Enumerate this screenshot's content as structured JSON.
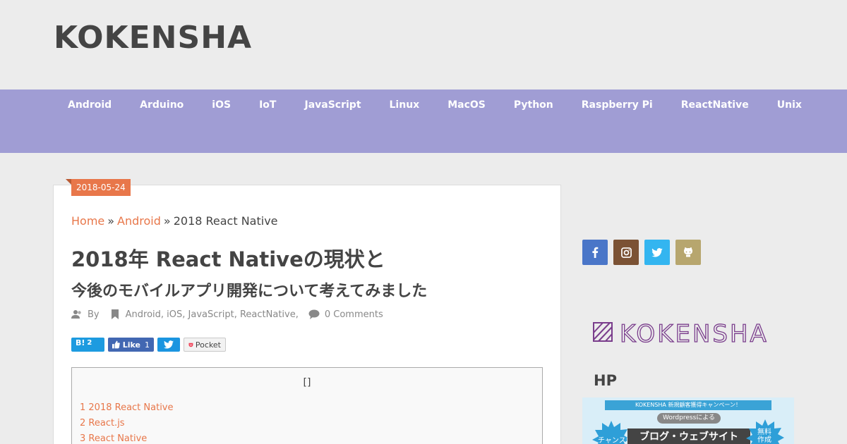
{
  "site": {
    "title": "KOKENSHA"
  },
  "nav": {
    "items": [
      "Android",
      "Arduino",
      "iOS",
      "IoT",
      "JavaScript",
      "Linux",
      "MacOS",
      "Python",
      "Raspberry Pi",
      "ReactNative",
      "Unix"
    ]
  },
  "post": {
    "date": "2018-05-24",
    "breadcrumb": {
      "home": "Home",
      "category": "Android",
      "current": "2018 React Native"
    },
    "title": "2018年 React Nativeの現状と",
    "subtitle": "今後のモバイルアプリ開発について考えてみました",
    "meta": {
      "by": "By",
      "categories": [
        "Android",
        "iOS",
        "JavaScript",
        "ReactNative"
      ],
      "comments": "0 Comments"
    },
    "share": {
      "hatena_label": "B!",
      "hatena_count": "2",
      "like_label": "Like",
      "like_count": "1",
      "pocket_label": "Pocket"
    },
    "toc": {
      "title": "[]",
      "items": [
        "1 2018 React Native",
        "2 React.js",
        "3 React Native"
      ]
    }
  },
  "sidebar": {
    "social": [
      {
        "name": "facebook-icon",
        "color": "#4a76c8"
      },
      {
        "name": "instagram-icon",
        "color": "#7b5234"
      },
      {
        "name": "twitter-icon",
        "color": "#33b5f0"
      },
      {
        "name": "github-icon",
        "color": "#b7a66e"
      }
    ],
    "logo_text": "KOKENSHA",
    "hp_title": "HP",
    "banner": {
      "top_line": "KOKENSHA 新規顧客獲得キャンペーン！",
      "pill": "Wordpressによる",
      "headline": "ブログ・ウェブサイト",
      "left_badge": "チャンス!",
      "right_badge": "無料作成"
    }
  },
  "colors": {
    "accent": "#e8774a",
    "nav_bg": "#a09dd4",
    "logo": "#7a3d8c"
  }
}
